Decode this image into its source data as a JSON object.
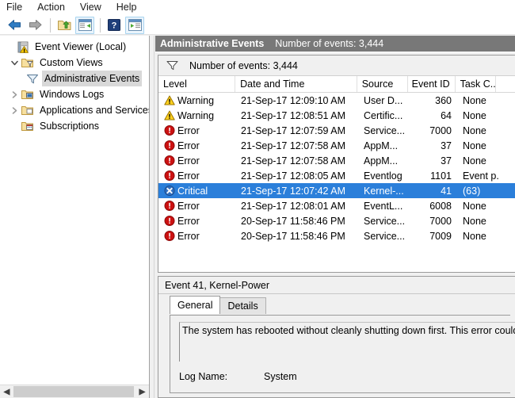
{
  "menubar": {
    "items": [
      {
        "label": "File",
        "name": "menu-file"
      },
      {
        "label": "Action",
        "name": "menu-action"
      },
      {
        "label": "View",
        "name": "menu-view"
      },
      {
        "label": "Help",
        "name": "menu-help"
      }
    ]
  },
  "toolbar": {
    "buttons": [
      {
        "icon": "back-arrow-icon",
        "name": "toolbar-back-button"
      },
      {
        "icon": "forward-arrow-icon",
        "name": "toolbar-forward-button"
      },
      {
        "icon": "folder-up-icon",
        "name": "toolbar-up-one-level-button"
      },
      {
        "icon": "show-hide-console-tree-icon",
        "name": "toolbar-show-hide-console-tree-button"
      },
      {
        "icon": "help-icon",
        "name": "toolbar-help-button"
      },
      {
        "icon": "show-hide-action-pane-icon",
        "name": "toolbar-show-hide-action-pane-button"
      }
    ]
  },
  "tree": {
    "nodes": [
      {
        "label": "Event Viewer (Local)",
        "icon": "event-viewer-icon",
        "indent": 0,
        "twist": "",
        "selected": false,
        "name": "tree-item-event-viewer-local"
      },
      {
        "label": "Custom Views",
        "icon": "custom-views-folder-icon",
        "indent": 1,
        "twist": "expanded",
        "selected": false,
        "name": "tree-item-custom-views"
      },
      {
        "label": "Administrative Events",
        "icon": "filter-funnel-icon",
        "indent": 2,
        "twist": "",
        "selected": true,
        "name": "tree-item-administrative-events"
      },
      {
        "label": "Windows Logs",
        "icon": "windows-logs-folder-icon",
        "indent": 1,
        "twist": "collapsed",
        "selected": false,
        "name": "tree-item-windows-logs"
      },
      {
        "label": "Applications and Services Lo",
        "icon": "applications-folder-icon",
        "indent": 1,
        "twist": "collapsed",
        "selected": false,
        "name": "tree-item-applications-and-services-logs"
      },
      {
        "label": "Subscriptions",
        "icon": "subscriptions-icon",
        "indent": 1,
        "twist": "",
        "selected": false,
        "name": "tree-item-subscriptions"
      }
    ]
  },
  "pane_header": {
    "title": "Administrative Events",
    "count": "Number of events: 3,444"
  },
  "filter_bar": {
    "text": "Number of events: 3,444"
  },
  "list": {
    "columns": [
      {
        "label": "Level",
        "key": "level"
      },
      {
        "label": "Date and Time",
        "key": "date"
      },
      {
        "label": "Source",
        "key": "source"
      },
      {
        "label": "Event ID",
        "key": "event_id"
      },
      {
        "label": "Task C...",
        "key": "task"
      }
    ],
    "rows": [
      {
        "level": "Warning",
        "icon": "warning-icon",
        "date": "21-Sep-17 12:09:10 AM",
        "source": "User D...",
        "event_id": "360",
        "task": "None",
        "selected": false
      },
      {
        "level": "Warning",
        "icon": "warning-icon",
        "date": "21-Sep-17 12:08:51 AM",
        "source": "Certific...",
        "event_id": "64",
        "task": "None",
        "selected": false
      },
      {
        "level": "Error",
        "icon": "error-icon",
        "date": "21-Sep-17 12:07:59 AM",
        "source": "Service...",
        "event_id": "7000",
        "task": "None",
        "selected": false
      },
      {
        "level": "Error",
        "icon": "error-icon",
        "date": "21-Sep-17 12:07:58 AM",
        "source": "AppM...",
        "event_id": "37",
        "task": "None",
        "selected": false
      },
      {
        "level": "Error",
        "icon": "error-icon",
        "date": "21-Sep-17 12:07:58 AM",
        "source": "AppM...",
        "event_id": "37",
        "task": "None",
        "selected": false
      },
      {
        "level": "Error",
        "icon": "error-icon",
        "date": "21-Sep-17 12:08:05 AM",
        "source": "Eventlog",
        "event_id": "1101",
        "task": "Event p...",
        "selected": false
      },
      {
        "level": "Critical",
        "icon": "critical-icon",
        "date": "21-Sep-17 12:07:42 AM",
        "source": "Kernel-...",
        "event_id": "41",
        "task": "(63)",
        "selected": true
      },
      {
        "level": "Error",
        "icon": "error-icon",
        "date": "21-Sep-17 12:08:01 AM",
        "source": "EventL...",
        "event_id": "6008",
        "task": "None",
        "selected": false
      },
      {
        "level": "Error",
        "icon": "error-icon",
        "date": "20-Sep-17 11:58:46 PM",
        "source": "Service...",
        "event_id": "7000",
        "task": "None",
        "selected": false
      },
      {
        "level": "Error",
        "icon": "error-icon",
        "date": "20-Sep-17 11:58:46 PM",
        "source": "Service...",
        "event_id": "7009",
        "task": "None",
        "selected": false
      }
    ]
  },
  "detail": {
    "title": "Event 41, Kernel-Power",
    "tabs": [
      {
        "label": "General",
        "active": true
      },
      {
        "label": "Details",
        "active": false
      }
    ],
    "description": "The system has rebooted without cleanly shutting down first. This error could be",
    "log_name_label": "Log Name:",
    "log_name_value": "System"
  },
  "colors": {
    "header_bar": "#787878",
    "selection": "#2b7fda",
    "warning": "#ffcc00",
    "error": "#cc0000",
    "critical": "#1e5fb4"
  }
}
